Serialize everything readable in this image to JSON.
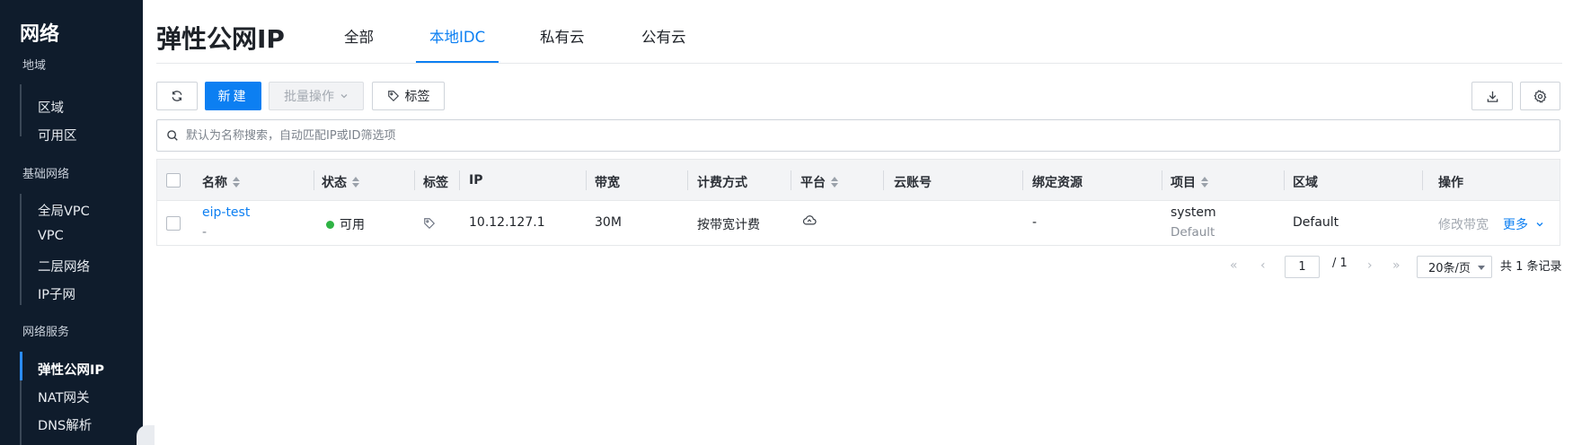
{
  "sidebar": {
    "title": "网络",
    "groups": [
      {
        "label": "地域",
        "items": [
          "区域",
          "可用区"
        ]
      },
      {
        "label": "基础网络",
        "items": [
          "全局VPC",
          "VPC",
          "二层网络",
          "IP子网"
        ]
      },
      {
        "label": "网络服务",
        "items": [
          "弹性公网IP",
          "NAT网关",
          "DNS解析"
        ]
      }
    ],
    "active_item": "弹性公网IP"
  },
  "header": {
    "title": "弹性公网IP",
    "tabs": [
      {
        "label": "全部",
        "active": false
      },
      {
        "label": "本地IDC",
        "active": true
      },
      {
        "label": "私有云",
        "active": false
      },
      {
        "label": "公有云",
        "active": false
      }
    ]
  },
  "toolbar": {
    "refresh_icon": "refresh-icon",
    "new_label": "新建",
    "batch_label": "批量操作",
    "tag_label": "标签",
    "download_icon": "download-icon",
    "settings_icon": "gear-icon"
  },
  "search": {
    "placeholder": "默认为名称搜索，自动匹配IP或ID筛选项"
  },
  "table": {
    "columns": [
      "名称",
      "状态",
      "标签",
      "IP",
      "带宽",
      "计费方式",
      "平台",
      "云账号",
      "绑定资源",
      "项目",
      "区域",
      "操作"
    ],
    "rows": [
      {
        "name": "eip-test",
        "name_sub": "-",
        "status": "可用",
        "ip": "10.12.127.1",
        "bandwidth": "30M",
        "billing": "按带宽计费",
        "cloud_account": "",
        "bound_resource": "-",
        "project": "system",
        "project_sub": "Default",
        "region": "Default",
        "action_modify": "修改带宽",
        "action_more": "更多"
      }
    ]
  },
  "pagination": {
    "current_page": "1",
    "total_pages": "/ 1",
    "page_size": "20条/页",
    "total": "共 1 条记录"
  },
  "colors": {
    "accent": "#0c7ff2",
    "sidebar_bg": "#0f1c2c",
    "status_ok": "#2fb344"
  }
}
